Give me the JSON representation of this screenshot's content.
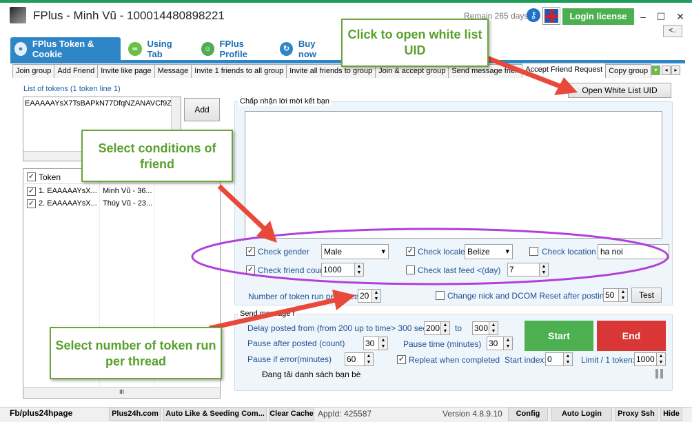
{
  "window": {
    "title": "FPlus - Minh Vũ - 100014480898221",
    "remain": "Remain 265 days",
    "login_label": "Login license",
    "collapse": "<..",
    "minimize": "–",
    "maximize": "☐",
    "close": "✕"
  },
  "main_tabs": [
    {
      "label": "FPlus Token & Cookie"
    },
    {
      "label": "Using Tab"
    },
    {
      "label": "FPlus Profile"
    },
    {
      "label": "Buy now"
    }
  ],
  "sub_tabs": [
    "Join group",
    "Add Friend",
    "Invite like page",
    "Message",
    "Invite 1 friends to all group",
    "Invite all friends to group",
    "Join & accept group",
    "Send message frien",
    "Accept Friend Request",
    "Copy group"
  ],
  "tokens": {
    "label": "List of tokens (1 token line 1)",
    "value": "EAAAAAYsX7TsBAPkN77DfqNZANAVCf9Z",
    "add_label": "Add",
    "column": "Token",
    "rows": [
      {
        "token": "1. EAAAAAYsX...",
        "name": "Minh Vũ - 36..."
      },
      {
        "token": "2. EAAAAAYsX...",
        "name": "Thúy Vũ - 23..."
      }
    ],
    "hscroll": "III"
  },
  "panel": {
    "title": "Chấp nhận lời mời kết bạn",
    "open_whitelist": "Open White List UID"
  },
  "conditions": {
    "check_gender": "Check gender",
    "gender": "Male",
    "check_locale": "Check locale",
    "locale": "Belize",
    "check_location": "Check location",
    "location": "ha noi",
    "check_friend_count": "Check friend count",
    "friend_count": "1000",
    "check_last_feed": "Check last feed <(day)",
    "last_feed": "7"
  },
  "threads": {
    "label": "Number of token run per thread:",
    "value": "20",
    "reset_label": "Change nick and DCOM Reset after posting is",
    "reset_value": "50",
    "test_label": "Test"
  },
  "send": {
    "group_title": "Send message f",
    "delay_label": "Delay posted from (from 200 up to time> 300 seconds)",
    "delay_from": "200",
    "to_label": "to",
    "delay_to": "300",
    "pause_after_label": "Pause after posted (count)",
    "pause_after": "30",
    "pause_time_label": "Pause time (minutes)",
    "pause_time": "30",
    "pause_error_label": "Pause if error(minutes)",
    "pause_error": "60",
    "repeat_label": "Repleat when completed",
    "start_index_label": "Start index:",
    "start_index": "0",
    "limit_label": "Limit / 1 token:",
    "limit": "1000",
    "start_label": "Start",
    "end_label": "End",
    "status": "Đang tải danh sách bạn bè"
  },
  "callouts": {
    "whitelist": "Click to open white list UID",
    "conditions": "Select conditions of friend",
    "threads": "Select number of token run per thread"
  },
  "statusbar": {
    "fb": "Fb/plus24hpage",
    "site": "Plus24h.com",
    "auto_like": "Auto Like & Seeding Com...",
    "clear_cache": "Clear Cache",
    "appid": "AppId: 425587",
    "version": "Version 4.8.9.10",
    "config": "Config",
    "auto_login": "Auto Login",
    "proxy": "Proxy Ssh",
    "hide": "Hide"
  },
  "colors": {
    "accent": "#2f86c7",
    "start": "#4caf50",
    "end": "#d93636",
    "callout": "#5aa02c",
    "arrow": "#e8493a",
    "ellipse": "#b23fd9"
  }
}
